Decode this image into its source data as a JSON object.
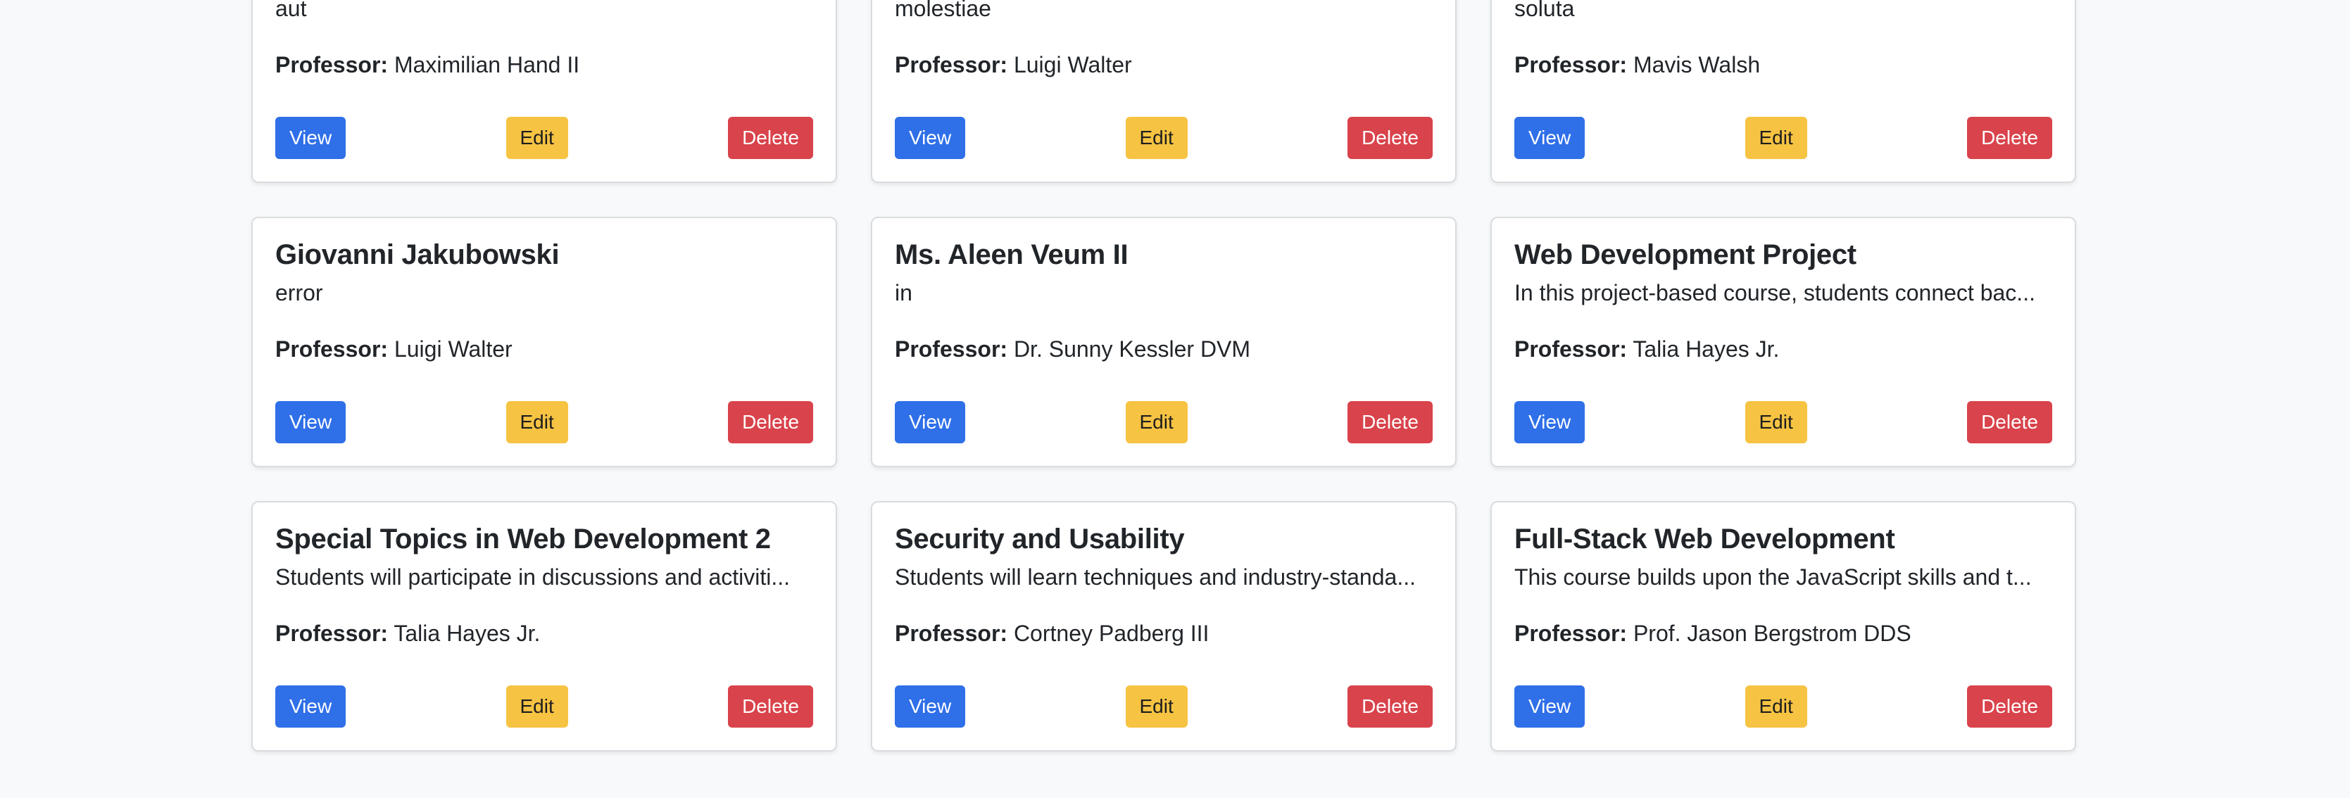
{
  "colors": {
    "background": "#f8f9fa",
    "view_button": "#2f6fe8",
    "edit_button": "#f6c343",
    "delete_button": "#d9434b"
  },
  "labels": {
    "professor": "Professor:",
    "view": "View",
    "edit": "Edit",
    "delete": "Delete"
  },
  "courses": [
    {
      "title": "",
      "description": "aut",
      "professor": "Maximilian Hand II"
    },
    {
      "title": "",
      "description": "molestiae",
      "professor": "Luigi Walter"
    },
    {
      "title": "",
      "description": "soluta",
      "professor": "Mavis Walsh"
    },
    {
      "title": "Giovanni Jakubowski",
      "description": "error",
      "professor": "Luigi Walter"
    },
    {
      "title": "Ms. Aleen Veum II",
      "description": "in",
      "professor": "Dr. Sunny Kessler DVM"
    },
    {
      "title": "Web Development Project",
      "description": "In this project-based course, students connect bac...",
      "professor": "Talia Hayes Jr."
    },
    {
      "title": "Special Topics in Web Development 2",
      "description": "Students will participate in discussions and activiti...",
      "professor": "Talia Hayes Jr."
    },
    {
      "title": "Security and Usability",
      "description": "Students will learn techniques and industry-standa...",
      "professor": "Cortney Padberg III"
    },
    {
      "title": "Full-Stack Web Development",
      "description": "This course builds upon the JavaScript skills and t...",
      "professor": "Prof. Jason Bergstrom DDS"
    }
  ]
}
